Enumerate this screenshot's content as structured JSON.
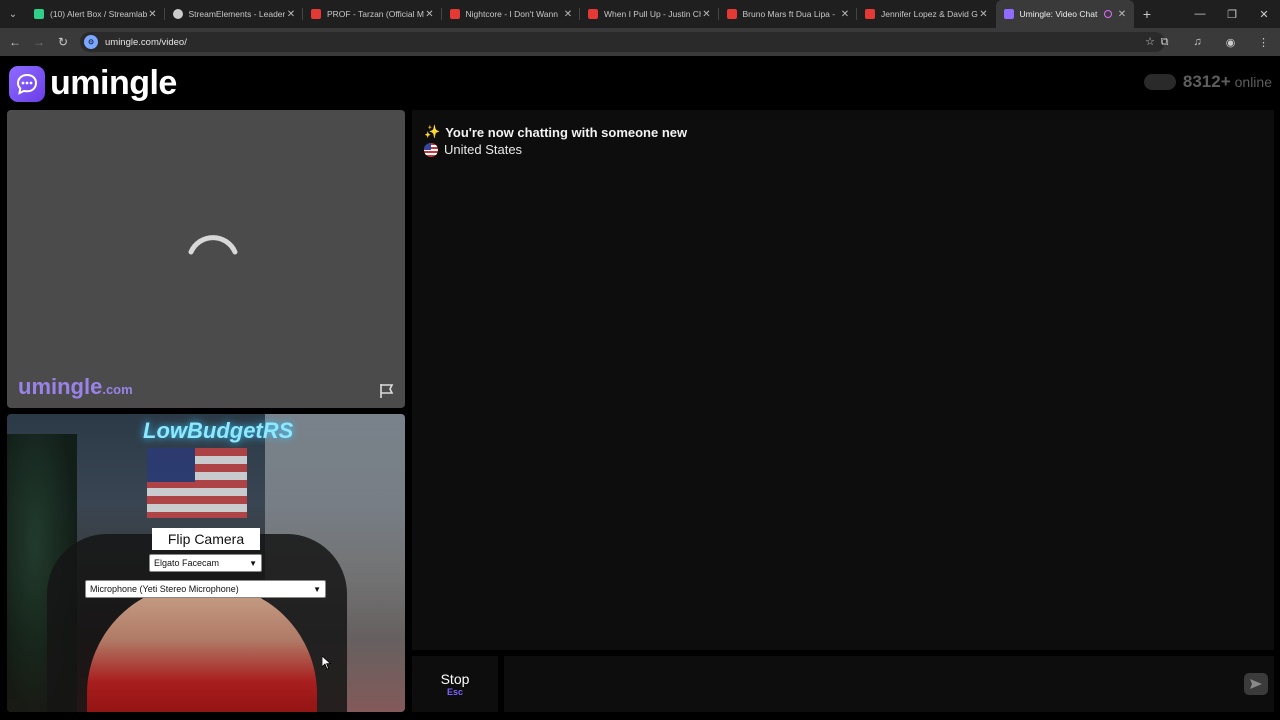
{
  "browser": {
    "tabs": [
      {
        "title": "(10) Alert Box / Streamlab",
        "favicon_color": "#2fd18a"
      },
      {
        "title": "StreamElements - Leaderb",
        "favicon_color": "#cccccc"
      },
      {
        "title": "PROF - Tarzan (Official Mu",
        "favicon_color": "#e53935"
      },
      {
        "title": "Nightcore - I Don't Wann",
        "favicon_color": "#e53935"
      },
      {
        "title": "When I Pull Up - Justin Ch",
        "favicon_color": "#e53935"
      },
      {
        "title": "Bruno Mars ft Dua Lipa - ",
        "favicon_color": "#e53935"
      },
      {
        "title": "Jennifer Lopez & David G",
        "favicon_color": "#e53935"
      },
      {
        "title": "Umingle: Video Chat",
        "favicon_color": "#8f6bff",
        "active": true
      }
    ],
    "url": "umingle.com/video/"
  },
  "header": {
    "logo_text": "umingle",
    "online_count": "8312+",
    "online_label": "online"
  },
  "stranger": {
    "watermark": "umingle",
    "watermark_suffix": ".com"
  },
  "self_cam": {
    "neon_sign": "LowBudgetRS",
    "flip_label": "Flip Camera",
    "camera_selected": "Elgato Facecam",
    "mic_selected": "Microphone (Yeti Stereo Microphone)"
  },
  "chat": {
    "status_message": "You're now chatting with someone new",
    "country": "United States"
  },
  "controls": {
    "stop_label": "Stop",
    "stop_key": "Esc"
  },
  "colors": {
    "accent": "#8f6bff",
    "panel_bg": "#0d0d0d",
    "video_placeholder": "#4b4b4b"
  }
}
